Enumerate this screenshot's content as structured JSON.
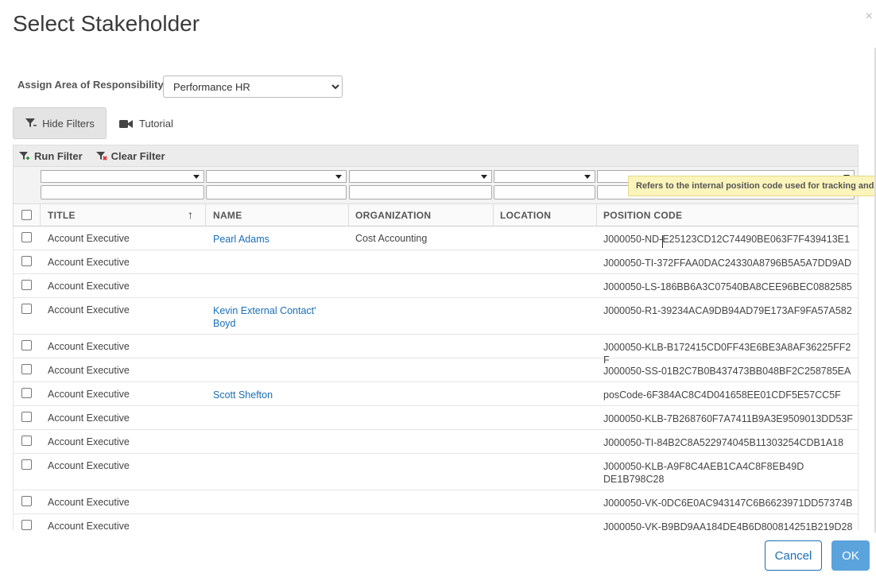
{
  "dialog": {
    "title": "Select Stakeholder",
    "close_icon": "×"
  },
  "aor": {
    "label": "Assign Area of Responsibility:",
    "selected": "Performance HR"
  },
  "actions": {
    "hide_filters": "Hide Filters",
    "tutorial": "Tutorial"
  },
  "toolbar": {
    "run_filter": "Run Filter",
    "clear_filter": "Clear Filter"
  },
  "columns": {
    "title": "TITLE",
    "name": "NAME",
    "organization": "ORGANIZATION",
    "location": "LOCATION",
    "position_code": "POSITION CODE"
  },
  "tooltip": "Refers to the internal position code used for tracking and r",
  "rows": [
    {
      "title": "Account Executive",
      "name": "Pearl Adams",
      "organization": "Cost Accounting",
      "location": "",
      "position_code": "J000050-ND-E25123CD12C74490BE063F7F439413E1"
    },
    {
      "title": "Account Executive",
      "name": "",
      "organization": "",
      "location": "",
      "position_code": "J000050-TI-372FFAA0DAC24330A8796B5A5A7DD9AD"
    },
    {
      "title": "Account Executive",
      "name": "",
      "organization": "",
      "location": "",
      "position_code": "J000050-LS-186BB6A3C07540BA8CEE96BEC0882585"
    },
    {
      "title": "Account Executive",
      "name": "Kevin External Contact' Boyd",
      "organization": "",
      "location": "",
      "position_code": "J000050-R1-39234ACA9DB94AD79E173AF9FA57A582"
    },
    {
      "title": "Account Executive",
      "name": "",
      "organization": "",
      "location": "",
      "position_code": "J000050-KLB-B172415CD0FF43E6BE3A8AF36225FF2F"
    },
    {
      "title": "Account Executive",
      "name": "",
      "organization": "",
      "location": "",
      "position_code": "J000050-SS-01B2C7B0B437473BB048BF2C258785EA"
    },
    {
      "title": "Account Executive",
      "name": "Scott Shefton",
      "organization": "",
      "location": "",
      "position_code": "posCode-6F384AC8C4D041658EE01CDF5E57CC5F"
    },
    {
      "title": "Account Executive",
      "name": "",
      "organization": "",
      "location": "",
      "position_code": "J000050-KLB-7B268760F7A7411B9A3E9509013DD53F"
    },
    {
      "title": "Account Executive",
      "name": "",
      "organization": "",
      "location": "",
      "position_code": "J000050-TI-84B2C8A522974045B11303254CDB1A18"
    },
    {
      "title": "Account Executive",
      "name": "",
      "organization": "",
      "location": "",
      "position_code": "J000050-KLB-A9F8C4AEB1CA4C8F8EB49DDE1B798C28"
    },
    {
      "title": "Account Executive",
      "name": "",
      "organization": "",
      "location": "",
      "position_code": "J000050-VK-0DC6E0AC943147C6B6623971DD57374B"
    },
    {
      "title": "Account Executive",
      "name": "",
      "organization": "",
      "location": "",
      "position_code": "J000050-VK-B9BD9AA184DE4B6D800814251B219D28"
    }
  ],
  "footer": {
    "cancel": "Cancel",
    "ok": "OK"
  }
}
